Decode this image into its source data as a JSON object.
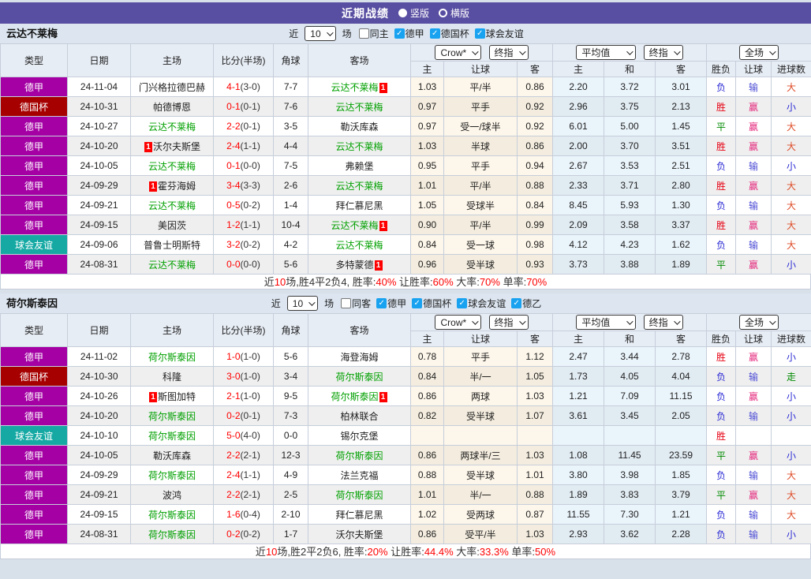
{
  "titlebar": {
    "title": "近期战绩",
    "radio_options": [
      {
        "label": "竖版",
        "selected": true
      },
      {
        "label": "横版",
        "selected": false
      }
    ]
  },
  "columns": {
    "left": [
      "类型",
      "日期",
      "主场",
      "比分(半场)",
      "角球",
      "客场"
    ],
    "selects": {
      "odds": "Crow*",
      "odds_final": "终指",
      "avg": "平均值",
      "avg_final": "终指",
      "full": "全场"
    },
    "odds_sub": [
      "主",
      "让球",
      "客"
    ],
    "avg_sub": [
      "主",
      "和",
      "客"
    ],
    "result_sub": [
      "胜负",
      "让球",
      "进球数"
    ]
  },
  "colors": {
    "page-bg": "#D8E0EA",
    "titlebar-bg": "#584EA2",
    "checkbox-blue": "#18A2F0",
    "focal-team": "#00A000",
    "score-red": "#FF0000",
    "summary-red": "#FF0000"
  },
  "type_colors": {
    "德甲": "#A400A4",
    "德国杯": "#A60000",
    "球会友谊": "#16A9A4"
  },
  "result_colors": {
    "胜": "#E60012",
    "负": "#2B2BD5",
    "平": "#008A00",
    "赢": "#E4287C",
    "输": "#4B4BD5",
    "走": "#008A00",
    "大": "#DD4B27",
    "小": "#2B2BD5"
  },
  "sections": [
    {
      "team": "云达不莱梅",
      "filter": {
        "recent_label": "近",
        "count": "10",
        "games_label": "场",
        "same_label": "同主",
        "same_checked": false,
        "leagues": [
          {
            "label": "德甲",
            "checked": true
          },
          {
            "label": "德国杯",
            "checked": true
          },
          {
            "label": "球会友谊",
            "checked": true
          }
        ]
      },
      "rows": [
        {
          "type": "德甲",
          "date": "24-11-04",
          "home": {
            "name": "门兴格拉德巴赫"
          },
          "score": "4-1",
          "half": "(3-0)",
          "corner": "7-7",
          "away": {
            "name": "云达不莱梅",
            "focal": true,
            "badge": "after"
          },
          "odds": [
            "1.03",
            "平/半",
            "0.86"
          ],
          "avg": [
            "2.20",
            "3.72",
            "3.01"
          ],
          "res": [
            "负",
            "输",
            "大"
          ]
        },
        {
          "type": "德国杯",
          "date": "24-10-31",
          "home": {
            "name": "帕德博恩"
          },
          "score": "0-1",
          "half": "(0-1)",
          "corner": "7-6",
          "away": {
            "name": "云达不莱梅",
            "focal": true
          },
          "odds": [
            "0.97",
            "平手",
            "0.92"
          ],
          "avg": [
            "2.96",
            "3.75",
            "2.13"
          ],
          "res": [
            "胜",
            "赢",
            "小"
          ]
        },
        {
          "type": "德甲",
          "date": "24-10-27",
          "home": {
            "name": "云达不莱梅",
            "focal": true
          },
          "score": "2-2",
          "half": "(0-1)",
          "corner": "3-5",
          "away": {
            "name": "勒沃库森"
          },
          "odds": [
            "0.97",
            "受一/球半",
            "0.92"
          ],
          "avg": [
            "6.01",
            "5.00",
            "1.45"
          ],
          "res": [
            "平",
            "赢",
            "大"
          ]
        },
        {
          "type": "德甲",
          "date": "24-10-20",
          "home": {
            "name": "沃尔夫斯堡",
            "badge": "before"
          },
          "score": "2-4",
          "half": "(1-1)",
          "corner": "4-4",
          "away": {
            "name": "云达不莱梅",
            "focal": true
          },
          "odds": [
            "1.03",
            "半球",
            "0.86"
          ],
          "avg": [
            "2.00",
            "3.70",
            "3.51"
          ],
          "res": [
            "胜",
            "赢",
            "大"
          ]
        },
        {
          "type": "德甲",
          "date": "24-10-05",
          "home": {
            "name": "云达不莱梅",
            "focal": true
          },
          "score": "0-1",
          "half": "(0-0)",
          "corner": "7-5",
          "away": {
            "name": "弗赖堡"
          },
          "odds": [
            "0.95",
            "平手",
            "0.94"
          ],
          "avg": [
            "2.67",
            "3.53",
            "2.51"
          ],
          "res": [
            "负",
            "输",
            "小"
          ]
        },
        {
          "type": "德甲",
          "date": "24-09-29",
          "home": {
            "name": "霍芬海姆",
            "badge": "before"
          },
          "score": "3-4",
          "half": "(3-3)",
          "corner": "2-6",
          "away": {
            "name": "云达不莱梅",
            "focal": true
          },
          "odds": [
            "1.01",
            "平/半",
            "0.88"
          ],
          "avg": [
            "2.33",
            "3.71",
            "2.80"
          ],
          "res": [
            "胜",
            "赢",
            "大"
          ]
        },
        {
          "type": "德甲",
          "date": "24-09-21",
          "home": {
            "name": "云达不莱梅",
            "focal": true
          },
          "score": "0-5",
          "half": "(0-2)",
          "corner": "1-4",
          "away": {
            "name": "拜仁慕尼黑"
          },
          "odds": [
            "1.05",
            "受球半",
            "0.84"
          ],
          "avg": [
            "8.45",
            "5.93",
            "1.30"
          ],
          "res": [
            "负",
            "输",
            "大"
          ]
        },
        {
          "type": "德甲",
          "date": "24-09-15",
          "home": {
            "name": "美因茨"
          },
          "score": "1-2",
          "half": "(1-1)",
          "corner": "10-4",
          "away": {
            "name": "云达不莱梅",
            "focal": true,
            "badge": "after"
          },
          "odds": [
            "0.90",
            "平/半",
            "0.99"
          ],
          "avg": [
            "2.09",
            "3.58",
            "3.37"
          ],
          "res": [
            "胜",
            "赢",
            "大"
          ]
        },
        {
          "type": "球会友谊",
          "date": "24-09-06",
          "home": {
            "name": "普鲁士明斯特"
          },
          "score": "3-2",
          "half": "(0-2)",
          "corner": "4-2",
          "away": {
            "name": "云达不莱梅",
            "focal": true
          },
          "odds": [
            "0.84",
            "受一球",
            "0.98"
          ],
          "avg": [
            "4.12",
            "4.23",
            "1.62"
          ],
          "res": [
            "负",
            "输",
            "大"
          ]
        },
        {
          "type": "德甲",
          "date": "24-08-31",
          "home": {
            "name": "云达不莱梅",
            "focal": true
          },
          "score": "0-0",
          "half": "(0-0)",
          "corner": "5-6",
          "away": {
            "name": "多特蒙德",
            "badge": "after"
          },
          "odds": [
            "0.96",
            "受半球",
            "0.93"
          ],
          "avg": [
            "3.73",
            "3.88",
            "1.89"
          ],
          "res": [
            "平",
            "赢",
            "小"
          ]
        }
      ],
      "summary": [
        "近",
        "10",
        "场,胜4平2负4, 胜率:",
        "40%",
        " 让胜率:",
        "60%",
        " 大率:",
        "70%",
        " 单率:",
        "70%"
      ]
    },
    {
      "team": "荷尔斯泰因",
      "filter": {
        "recent_label": "近",
        "count": "10",
        "games_label": "场",
        "same_label": "同客",
        "same_checked": false,
        "leagues": [
          {
            "label": "德甲",
            "checked": true
          },
          {
            "label": "德国杯",
            "checked": true
          },
          {
            "label": "球会友谊",
            "checked": true
          },
          {
            "label": "德乙",
            "checked": true
          }
        ]
      },
      "rows": [
        {
          "type": "德甲",
          "date": "24-11-02",
          "home": {
            "name": "荷尔斯泰因",
            "focal": true
          },
          "score": "1-0",
          "half": "(1-0)",
          "corner": "5-6",
          "away": {
            "name": "海登海姆"
          },
          "odds": [
            "0.78",
            "平手",
            "1.12"
          ],
          "avg": [
            "2.47",
            "3.44",
            "2.78"
          ],
          "res": [
            "胜",
            "赢",
            "小"
          ]
        },
        {
          "type": "德国杯",
          "date": "24-10-30",
          "home": {
            "name": "科隆"
          },
          "score": "3-0",
          "half": "(1-0)",
          "corner": "3-4",
          "away": {
            "name": "荷尔斯泰因",
            "focal": true
          },
          "odds": [
            "0.84",
            "半/一",
            "1.05"
          ],
          "avg": [
            "1.73",
            "4.05",
            "4.04"
          ],
          "res": [
            "负",
            "输",
            "走"
          ]
        },
        {
          "type": "德甲",
          "date": "24-10-26",
          "home": {
            "name": "斯图加特",
            "badge": "before"
          },
          "score": "2-1",
          "half": "(1-0)",
          "corner": "9-5",
          "away": {
            "name": "荷尔斯泰因",
            "focal": true,
            "badge": "after"
          },
          "odds": [
            "0.86",
            "两球",
            "1.03"
          ],
          "avg": [
            "1.21",
            "7.09",
            "11.15"
          ],
          "res": [
            "负",
            "赢",
            "小"
          ]
        },
        {
          "type": "德甲",
          "date": "24-10-20",
          "home": {
            "name": "荷尔斯泰因",
            "focal": true
          },
          "score": "0-2",
          "half": "(0-1)",
          "corner": "7-3",
          "away": {
            "name": "柏林联合"
          },
          "odds": [
            "0.82",
            "受半球",
            "1.07"
          ],
          "avg": [
            "3.61",
            "3.45",
            "2.05"
          ],
          "res": [
            "负",
            "输",
            "小"
          ]
        },
        {
          "type": "球会友谊",
          "date": "24-10-10",
          "home": {
            "name": "荷尔斯泰因",
            "focal": true
          },
          "score": "5-0",
          "half": "(4-0)",
          "corner": "0-0",
          "away": {
            "name": "锡尔克堡"
          },
          "odds": [
            "",
            "",
            ""
          ],
          "avg": [
            "",
            "",
            ""
          ],
          "res": [
            "胜",
            "",
            ""
          ]
        },
        {
          "type": "德甲",
          "date": "24-10-05",
          "home": {
            "name": "勒沃库森"
          },
          "score": "2-2",
          "half": "(2-1)",
          "corner": "12-3",
          "away": {
            "name": "荷尔斯泰因",
            "focal": true
          },
          "odds": [
            "0.86",
            "两球半/三",
            "1.03"
          ],
          "avg": [
            "1.08",
            "11.45",
            "23.59"
          ],
          "res": [
            "平",
            "赢",
            "小"
          ]
        },
        {
          "type": "德甲",
          "date": "24-09-29",
          "home": {
            "name": "荷尔斯泰因",
            "focal": true
          },
          "score": "2-4",
          "half": "(1-1)",
          "corner": "4-9",
          "away": {
            "name": "法兰克福"
          },
          "odds": [
            "0.88",
            "受半球",
            "1.01"
          ],
          "avg": [
            "3.80",
            "3.98",
            "1.85"
          ],
          "res": [
            "负",
            "输",
            "大"
          ]
        },
        {
          "type": "德甲",
          "date": "24-09-21",
          "home": {
            "name": "波鸿"
          },
          "score": "2-2",
          "half": "(2-1)",
          "corner": "2-5",
          "away": {
            "name": "荷尔斯泰因",
            "focal": true
          },
          "odds": [
            "1.01",
            "半/一",
            "0.88"
          ],
          "avg": [
            "1.89",
            "3.83",
            "3.79"
          ],
          "res": [
            "平",
            "赢",
            "大"
          ]
        },
        {
          "type": "德甲",
          "date": "24-09-15",
          "home": {
            "name": "荷尔斯泰因",
            "focal": true
          },
          "score": "1-6",
          "half": "(0-4)",
          "corner": "2-10",
          "away": {
            "name": "拜仁慕尼黑"
          },
          "odds": [
            "1.02",
            "受两球",
            "0.87"
          ],
          "avg": [
            "11.55",
            "7.30",
            "1.21"
          ],
          "res": [
            "负",
            "输",
            "大"
          ]
        },
        {
          "type": "德甲",
          "date": "24-08-31",
          "home": {
            "name": "荷尔斯泰因",
            "focal": true
          },
          "score": "0-2",
          "half": "(0-2)",
          "corner": "1-7",
          "away": {
            "name": "沃尔夫斯堡"
          },
          "odds": [
            "0.86",
            "受平/半",
            "1.03"
          ],
          "avg": [
            "2.93",
            "3.62",
            "2.28"
          ],
          "res": [
            "负",
            "输",
            "小"
          ]
        }
      ],
      "summary": [
        "近",
        "10",
        "场,胜2平2负6, 胜率:",
        "20%",
        " 让胜率:",
        "44.4%",
        " 大率:",
        "33.3%",
        " 单率:",
        "50%"
      ]
    }
  ]
}
